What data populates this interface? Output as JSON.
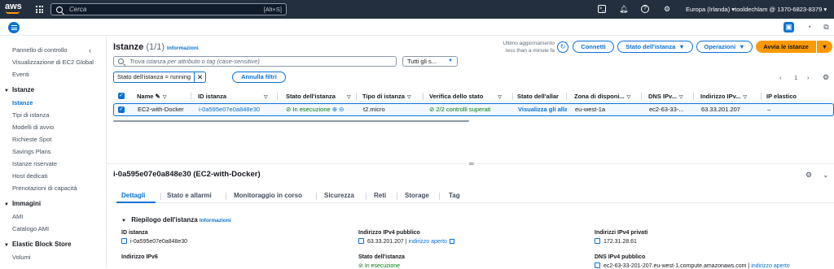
{
  "topbar": {
    "logo": "aws",
    "search_placeholder": "Cerca",
    "search_shortcut": "[Alt+S]",
    "region": "Europa (Irlanda)",
    "account": "tooldechlam @ 1370-6823-8379",
    "icons": [
      "grid-icon",
      "search-icon",
      "cloudshell-icon",
      "bell-icon",
      "help-icon",
      "settings-icon"
    ]
  },
  "sidebar": {
    "collapse_icon": "‹",
    "items_top": [
      "Pannello di controllo",
      "Visualizzazione di EC2 Global",
      "Eventi"
    ],
    "sections": [
      {
        "title": "Istanze",
        "items": [
          "Istanze",
          "Tipi di istanza",
          "Modelli di avvio",
          "Richieste Spot",
          "Savings Plans",
          "Istanze riservate",
          "Host dedicati",
          "Prenotazioni di capacità"
        ]
      },
      {
        "title": "Immagini",
        "items": [
          "AMI",
          "Catalogo AMI"
        ]
      },
      {
        "title": "Elastic Block Store",
        "items": [
          "Volumi"
        ]
      }
    ],
    "active_item": "Istanze"
  },
  "list": {
    "title": "Istanze",
    "count": "(1/1)",
    "info": "Informazioni",
    "last_updated": "Ultimo aggiornamento less than a minute fa",
    "buttons": {
      "connect": "Connetti",
      "instance_state": "Stato dell'istanza",
      "operations": "Operazioni",
      "launch": "Avvia le istanze"
    },
    "search_placeholder": "Trova istanza per attributo o tag (case-sensitive)",
    "state_filter": "Tutti gli s...",
    "token": "Stato dell'istanza = running",
    "clear_filters": "Annulla filtri",
    "page": "1",
    "columns": [
      "Name",
      "ID istanza",
      "Stato dell'istanza",
      "Tipo di istanza",
      "Verifica dello stato",
      "Stato dell'allar",
      "Zona di disponi...",
      "DNS IPv...",
      "Indirizzo IPv...",
      "IP elastico"
    ],
    "rows": [
      {
        "name": "EC2-with-Docker",
        "id": "i-0a595e07e0a848e30",
        "state": "In esecuzione",
        "type": "t2.micro",
        "check": "2/2 controlli superati",
        "alarm": "Visualizza gli allar",
        "zone": "eu-west-1a",
        "dns": "ec2-63-33-...",
        "ipv4": "63.33.201.207",
        "elastic": "–"
      }
    ]
  },
  "details": {
    "title": "i-0a595e07e0a848e30 (EC2-with-Docker)",
    "tabs": [
      "Dettagli",
      "Stato e allarmi",
      "Monitoraggio in corso",
      "Sicurezza",
      "Reti",
      "Storage",
      "Tag"
    ],
    "active_tab": "Dettagli",
    "summary_title": "Riepilogo dell'istanza",
    "summary_info": "Informazioni",
    "fields": {
      "id_label": "ID istanza",
      "id_value": "i-0a595e07e0a848e30",
      "ipv6_label": "Indirizzo IPv6",
      "pub_ip_label": "Indirizzo IPv4 pubblico",
      "pub_ip_value": "63.33.201.207",
      "open_addr": "indirizzo aperto",
      "state_label": "Stato dell'istanza",
      "state_value": "In esecuzione",
      "priv_ip_label": "Indirizzi IPv4 privati",
      "priv_ip_value": "172.31.28.61",
      "pub_dns_label": "DNS IPv4 pubblico",
      "pub_dns_value": "ec2-63-33-201-207.eu-west-1.compute.amazonaws.com",
      "open_addr2": "indirizzo aperto"
    }
  }
}
